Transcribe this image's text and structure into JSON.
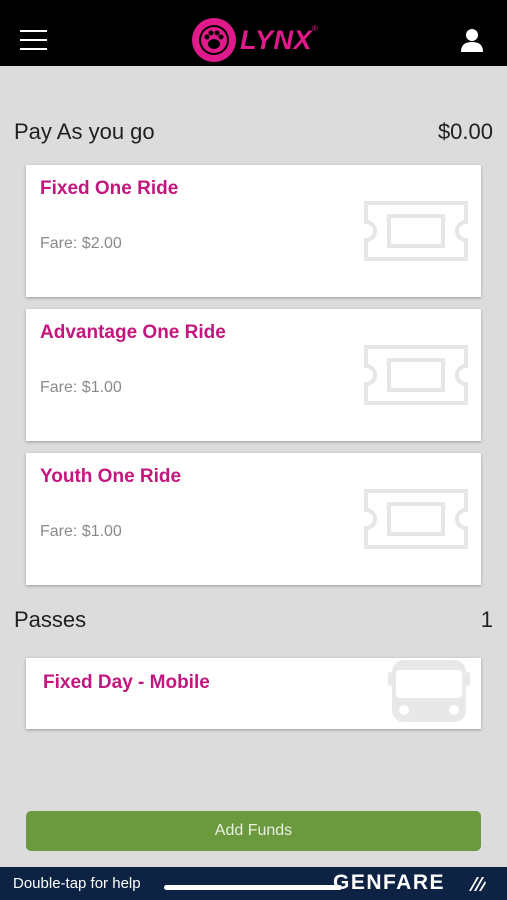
{
  "header": {
    "menu_icon": "hamburger-menu-icon",
    "logo_text": "LYNX",
    "logo_tm": "®",
    "account_icon": "user-icon",
    "brand_color": "#e01a8b"
  },
  "pay_as_you_go": {
    "title": "Pay As you go",
    "balance": "$0.00",
    "items": [
      {
        "title": "Fixed One Ride",
        "fare": "Fare: $2.00",
        "icon": "ticket-icon"
      },
      {
        "title": "Advantage One Ride",
        "fare": "Fare: $1.00",
        "icon": "ticket-icon"
      },
      {
        "title": "Youth One Ride",
        "fare": "Fare: $1.00",
        "icon": "ticket-icon"
      }
    ]
  },
  "passes": {
    "title": "Passes",
    "count": "1",
    "items": [
      {
        "title": "Fixed Day - Mobile",
        "icon": "bus-icon"
      }
    ]
  },
  "actions": {
    "add_funds_label": "Add Funds",
    "add_funds_color": "#6b9a3e"
  },
  "footer": {
    "help_text": "Double-tap for help",
    "brand": "GENFARE",
    "background": "#0e2244"
  }
}
